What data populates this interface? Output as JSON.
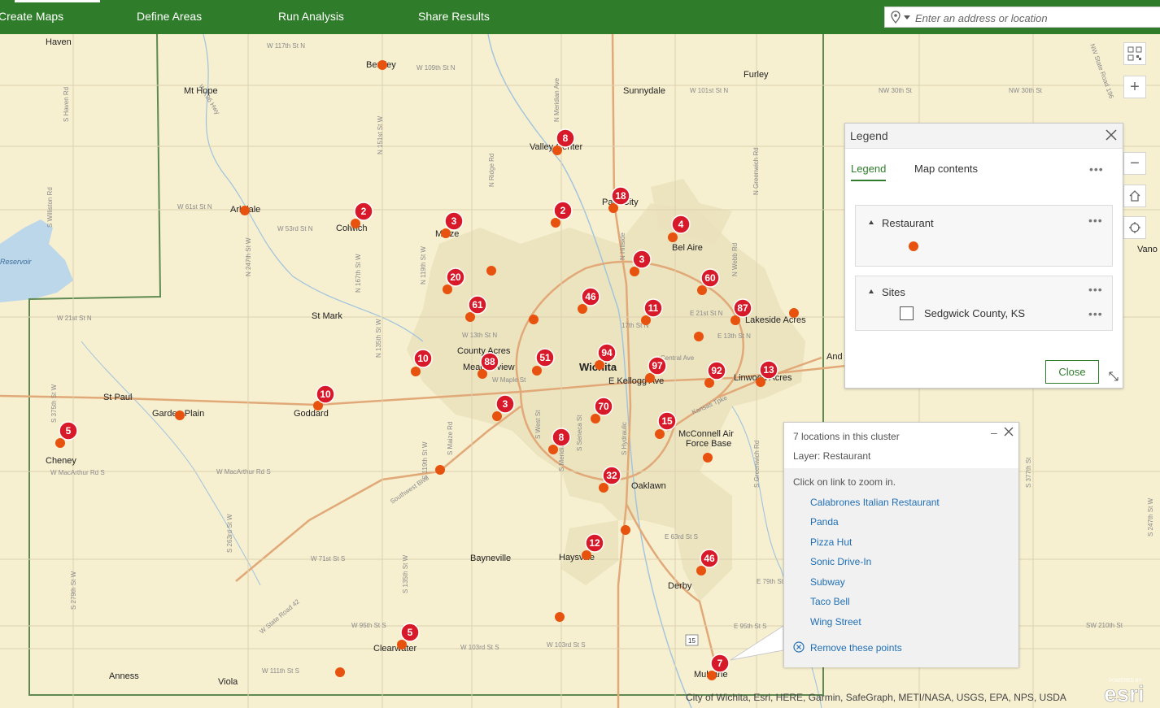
{
  "nav": {
    "tabs": [
      {
        "label": "Create Maps",
        "active": true
      },
      {
        "label": "Define Areas",
        "active": false
      },
      {
        "label": "Run Analysis",
        "active": false
      },
      {
        "label": "Share Results",
        "active": false
      }
    ]
  },
  "search": {
    "placeholder": "Enter an address or location"
  },
  "colors": {
    "brand_green": "#2f7d2a",
    "cluster_red": "#d7192a",
    "point_orange": "#e8520f",
    "link_blue": "#1f6fb5"
  },
  "map": {
    "places": {
      "haven": "Haven",
      "mt_hope": "Mt Hope",
      "bentley": "Bentley",
      "furley": "Furley",
      "sunnydale": "Sunnydale",
      "valley_center": "Valley Center",
      "park_city": "Park City",
      "arkdale": "Arkdale",
      "colwich": "Colwich",
      "maize": "Maize",
      "bel_aire": "Bel Aire",
      "st_mark": "St Mark",
      "lakeside_acres": "Lakeside Acres",
      "county_acres": "County Acres",
      "meadowview": "Meadowview",
      "wichita": "Wichita",
      "st_paul": "St Paul",
      "garden_plain": "Garden Plain",
      "goddard": "Goddard",
      "cheney": "Cheney",
      "mcconnell": "McConnell Air",
      "force_base": "Force Base",
      "linwood_acres": "Linwood Acres",
      "oaklawn": "Oaklawn",
      "bayneville": "Bayneville",
      "haysville": "Haysville",
      "derby": "Derby",
      "clearwater": "Clearwater",
      "anness": "Anness",
      "viola": "Viola",
      "mulvane": "Mulvane",
      "vano": "Vano",
      "and": "And",
      "reservoir": "Reservoir"
    },
    "roads": {
      "w117": "W 117th St N",
      "w109": "W 109th St N",
      "w101": "W 101st St N",
      "n30": "NW 30th St",
      "w30": "NW 30th St",
      "w61": "W 61st St N",
      "w53": "W 53rd St N",
      "w21": "W 21st St N",
      "w13": "W 13th St N",
      "w_maple": "W Maple St",
      "e_kellogg": "E Kellogg Ave",
      "k_tpke": "Kansas Tpke",
      "w_macarthur": "W MacArthur Rd S",
      "macarthur_rd": "W MacArthur Rd S",
      "w71": "W 71st St S",
      "w95": "W 95th St S",
      "w103": "W 103rd St S",
      "w103b": "W 103rd St S",
      "w111": "W 111th St S",
      "e63": "E 63rd St S",
      "e79": "E 79th St",
      "e95": "E 95th St S",
      "sw210": "SW 210th St",
      "southwest_blvd": "Southwest Blvd",
      "state_road42": "W State Road 42",
      "e21": "E 21st St N",
      "e13": "E 13th St N",
      "e17": "17th St N",
      "central": "Central Ave",
      "k96": "W K96 Hwy",
      "hwy15": "15",
      "s_haven": "S Haven Rd",
      "s_williston": "S Williston Rd",
      "s_247": "N 247th St W",
      "s_167": "N 167th St W",
      "n_151": "N 151st St W",
      "n_119": "N 119th St W",
      "ridge": "N Ridge Rd",
      "meridian": "N Meridian Ave",
      "greenwich": "N Greenwich Rd",
      "webb": "N Webb Rd",
      "s_greenwich": "S Greenwich Rd",
      "s_hydraulic": "S Hydraulic",
      "s_seneca": "S Seneca St",
      "s_meridian": "S Meridian Ave",
      "s_west": "S West St",
      "s_maize": "S Maize Rd",
      "s_119": "S 119th St W",
      "s_135": "S 135th St W",
      "s_263": "S 263rd St W",
      "s_279": "S 279th St W",
      "s_375": "S 375th St W",
      "s_hillside": "N Hillside",
      "nw_state": "NW State Road 196",
      "s_377": "S 377th St",
      "s_247b": "S 247th St W",
      "n_135": "N 135th St W"
    },
    "clusters": [
      {
        "id": "valley-center",
        "count": "8"
      },
      {
        "id": "park-city",
        "count": "18"
      },
      {
        "id": "colwich",
        "count": "2"
      },
      {
        "id": "maize",
        "count": "3"
      },
      {
        "id": "park-city-south",
        "count": "2"
      },
      {
        "id": "bel-aire",
        "count": "4"
      },
      {
        "id": "ne-wichita",
        "count": "3"
      },
      {
        "id": "maize-south",
        "count": "20"
      },
      {
        "id": "nw-wichita",
        "count": "61"
      },
      {
        "id": "north-wichita",
        "count": "46"
      },
      {
        "id": "northeast",
        "count": "60"
      },
      {
        "id": "n-central",
        "count": "11"
      },
      {
        "id": "lakeside",
        "count": "87"
      },
      {
        "id": "west-maize",
        "count": "10"
      },
      {
        "id": "meadowview",
        "count": "88"
      },
      {
        "id": "west-central",
        "count": "51"
      },
      {
        "id": "downtown",
        "count": "94"
      },
      {
        "id": "east-central",
        "count": "97"
      },
      {
        "id": "east-wichita",
        "count": "92"
      },
      {
        "id": "linwood",
        "count": "13"
      },
      {
        "id": "goddard",
        "count": "10"
      },
      {
        "id": "cheney",
        "count": "5"
      },
      {
        "id": "sw-wichita",
        "count": "3"
      },
      {
        "id": "south-central",
        "count": "70"
      },
      {
        "id": "mcconnell",
        "count": "15"
      },
      {
        "id": "south-wichita",
        "count": "8"
      },
      {
        "id": "oaklawn",
        "count": "32"
      },
      {
        "id": "haysville",
        "count": "12"
      },
      {
        "id": "derby",
        "count": "46"
      },
      {
        "id": "clearwater",
        "count": "5"
      },
      {
        "id": "mulvane",
        "count": "7"
      }
    ],
    "attribution": "City of Wichita, Esri, HERE, Garmin, SafeGraph, METI/NASA, USGS, EPA, NPS, USDA",
    "esri_logo": "esri",
    "esri_powered": "POWERED BY"
  },
  "controls": [
    "qr-grid-icon",
    "zoom-in-icon",
    "zoom-out-icon",
    "home-icon",
    "locate-icon"
  ],
  "legend": {
    "title": "Legend",
    "tabs": [
      {
        "label": "Legend",
        "active": true
      },
      {
        "label": "Map contents",
        "active": false
      }
    ],
    "groups": [
      {
        "name": "Restaurant",
        "symbol": "orange-dot"
      },
      {
        "name": "Sites",
        "item": "Sedgwick County, KS",
        "symbol": "outline-square"
      }
    ],
    "close_label": "Close"
  },
  "popup": {
    "title": "7 locations in this cluster",
    "layer": "Layer: Restaurant",
    "hint": "Click on link to zoom in.",
    "links": [
      "Calabrones Italian Restaurant",
      "Panda",
      "Pizza Hut",
      "Sonic Drive-In",
      "Subway",
      "Taco Bell",
      "Wing Street"
    ],
    "remove": "Remove these points"
  }
}
